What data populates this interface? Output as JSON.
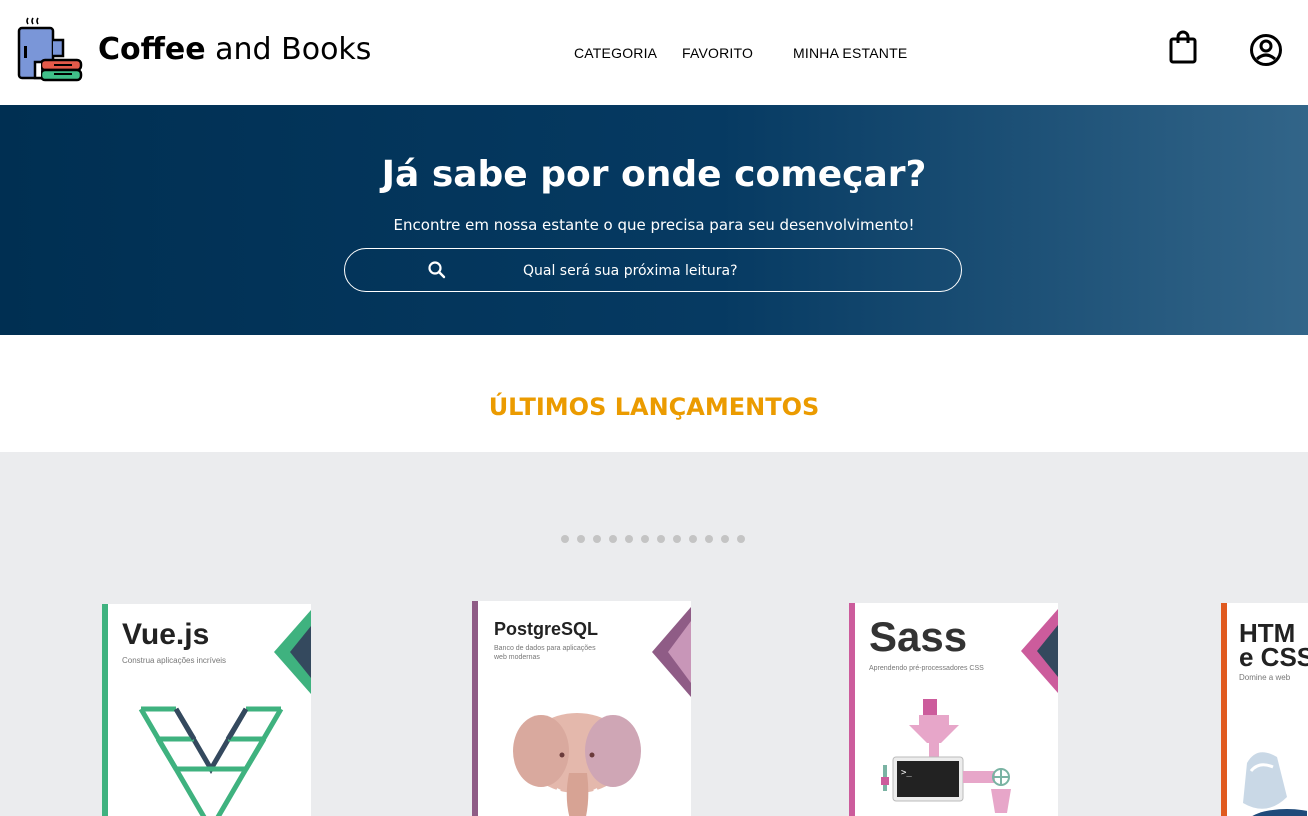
{
  "header": {
    "brand_bold": "Coffee",
    "brand_regular": " and Books",
    "nav": [
      "CATEGORIA",
      "FAVORITO",
      "MINHA ESTANTE"
    ],
    "icons": [
      "cart-bag-icon",
      "user-account-icon"
    ]
  },
  "hero": {
    "title": "Já sabe por onde começar?",
    "subtitle": "Encontre em nossa estante o que precisa para seu desenvolvimento!",
    "search_placeholder": "Qual será sua próxima leitura?"
  },
  "section": {
    "title": "ÚLTIMOS LANÇAMENTOS"
  },
  "carousel": {
    "dots_count": 12,
    "books": [
      {
        "title": "Vue.js",
        "subtitle": "Construa aplicações incríveis",
        "accent": "#3fb27f"
      },
      {
        "title": "PostgreSQL",
        "subtitle": "Banco de dados para aplicações",
        "subtitle_line2": "web modernas",
        "accent": "#8f5c86"
      },
      {
        "title": "Sass",
        "subtitle": "Aprendendo pré-processadores CSS",
        "accent": "#cc5c9c"
      },
      {
        "title": "HTM",
        "title_line2": "e CSS",
        "subtitle": "Domine a web",
        "accent": "#e05a1f"
      }
    ]
  },
  "colors": {
    "hero_dark": "#002f52",
    "section_title": "#eb9b00",
    "carousel_bg": "#ebecee"
  }
}
